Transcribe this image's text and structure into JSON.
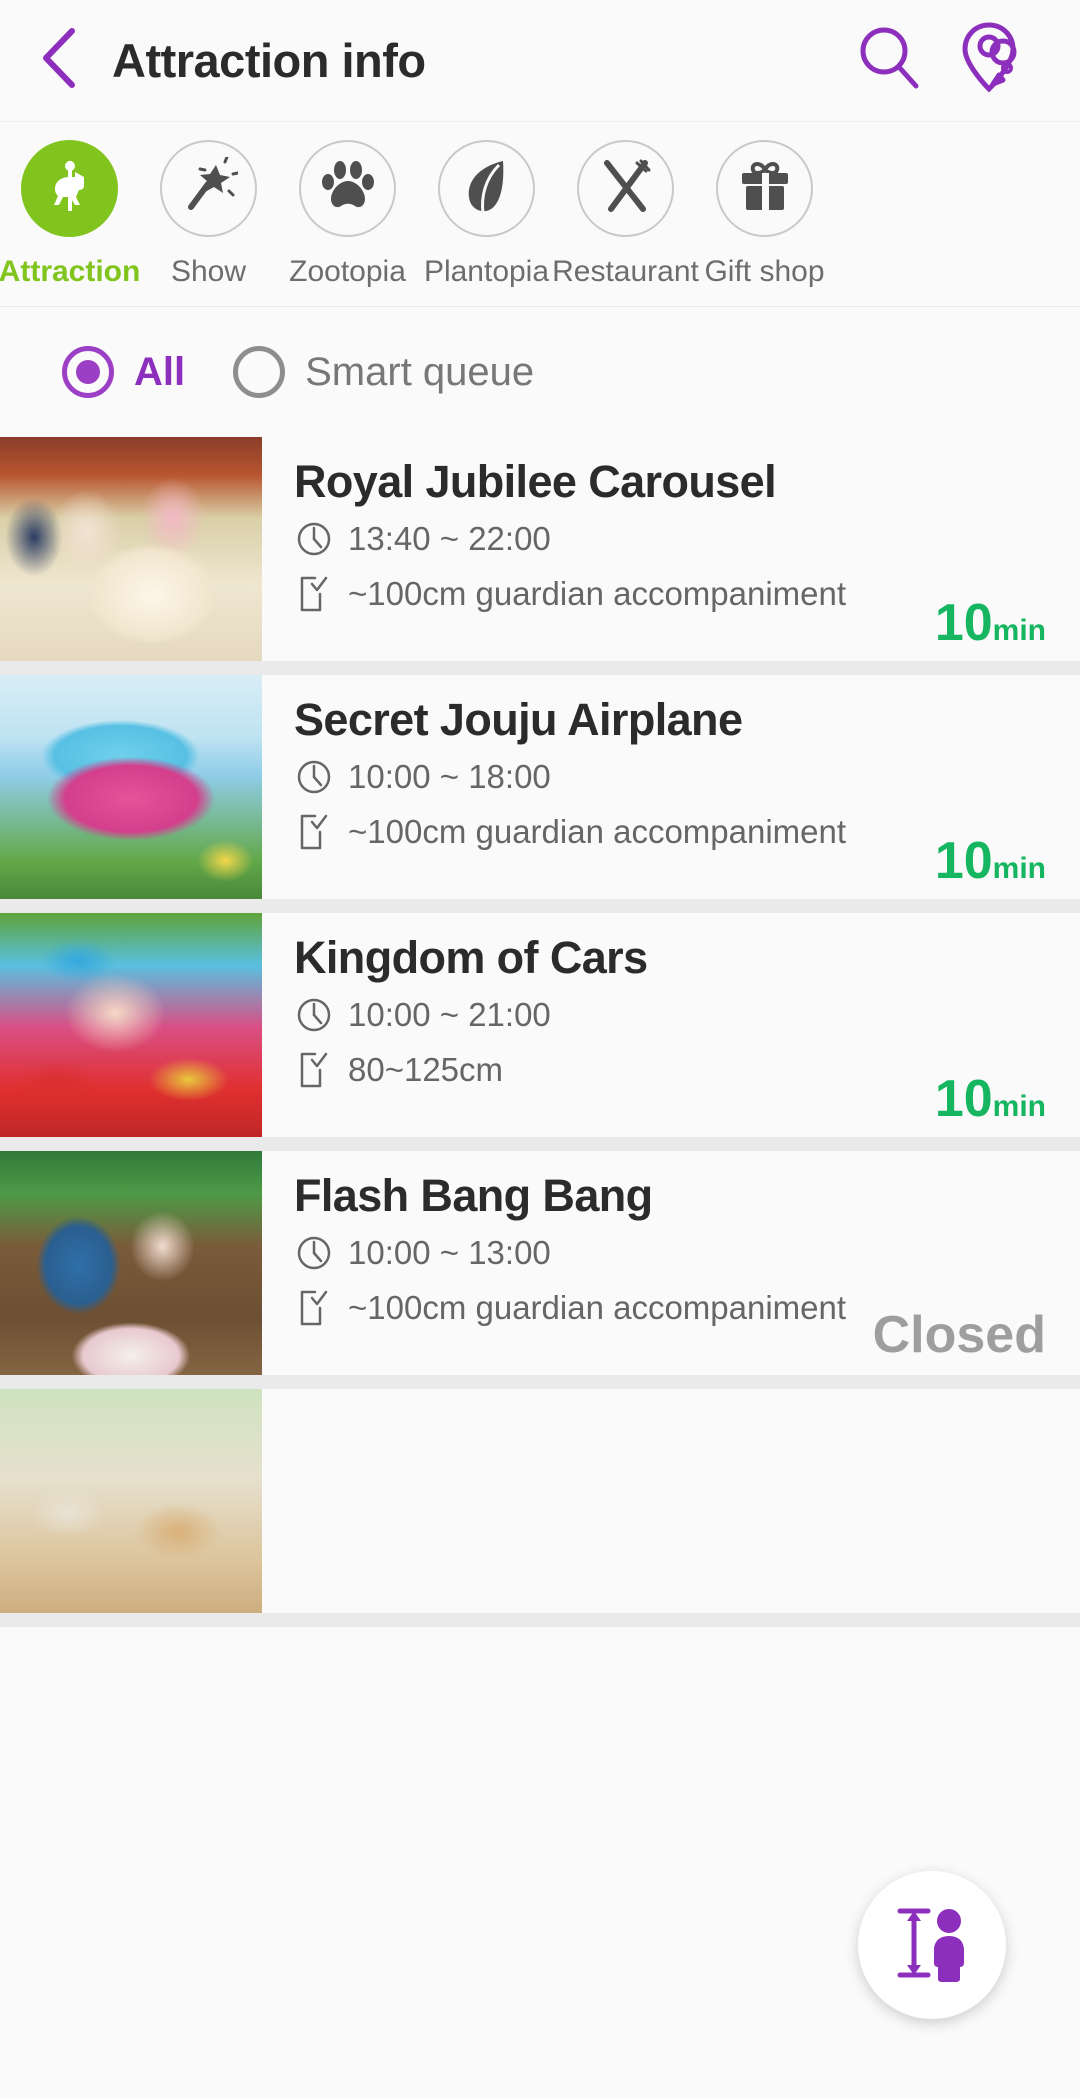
{
  "header": {
    "title": "Attraction info",
    "back_icon": "chevron-left-icon",
    "search_icon": "search-icon",
    "map_icon": "map-pin-icon",
    "accent_color": "#8d2fbd"
  },
  "categories": [
    {
      "label": "Attraction",
      "icon": "carousel-horse-icon",
      "active": true
    },
    {
      "label": "Show",
      "icon": "magic-wand-icon",
      "active": false
    },
    {
      "label": "Zootopia",
      "icon": "paw-print-icon",
      "active": false
    },
    {
      "label": "Plantopia",
      "icon": "leaf-icon",
      "active": false
    },
    {
      "label": "Restaurant",
      "icon": "fork-knife-icon",
      "active": false
    },
    {
      "label": "Gift shop",
      "icon": "gift-box-icon",
      "active": false
    }
  ],
  "filter": {
    "options": [
      {
        "label": "All",
        "selected": true
      },
      {
        "label": "Smart queue",
        "selected": false
      }
    ]
  },
  "attractions": [
    {
      "name": "Royal Jubilee Carousel",
      "hours": "13:40 ~ 22:00",
      "restriction": "~100cm guardian accompaniment",
      "wait_value": "10",
      "wait_unit": "min",
      "status": "open",
      "clock_icon": "clock-icon",
      "height_icon": "height-rule-icon"
    },
    {
      "name": "Secret Jouju Airplane",
      "hours": "10:00 ~ 18:00",
      "restriction": "~100cm guardian accompaniment",
      "wait_value": "10",
      "wait_unit": "min",
      "status": "open",
      "clock_icon": "clock-icon",
      "height_icon": "height-rule-icon"
    },
    {
      "name": "Kingdom of Cars",
      "hours": "10:00 ~ 21:00",
      "restriction": "80~125cm",
      "wait_value": "10",
      "wait_unit": "min",
      "status": "open",
      "clock_icon": "clock-icon",
      "height_icon": "height-rule-icon"
    },
    {
      "name": "Flash Bang Bang",
      "hours": "10:00 ~ 13:00",
      "restriction": "~100cm guardian accompaniment",
      "status_label": "Closed",
      "status": "closed",
      "clock_icon": "clock-icon",
      "height_icon": "height-rule-icon"
    }
  ],
  "fab": {
    "icon": "height-measure-person-icon",
    "color": "#8d2fbd"
  },
  "colors": {
    "accent_purple": "#8d2fbd",
    "active_green": "#81c41e",
    "wait_green": "#16b560",
    "closed_gray": "#9e9e9e"
  }
}
